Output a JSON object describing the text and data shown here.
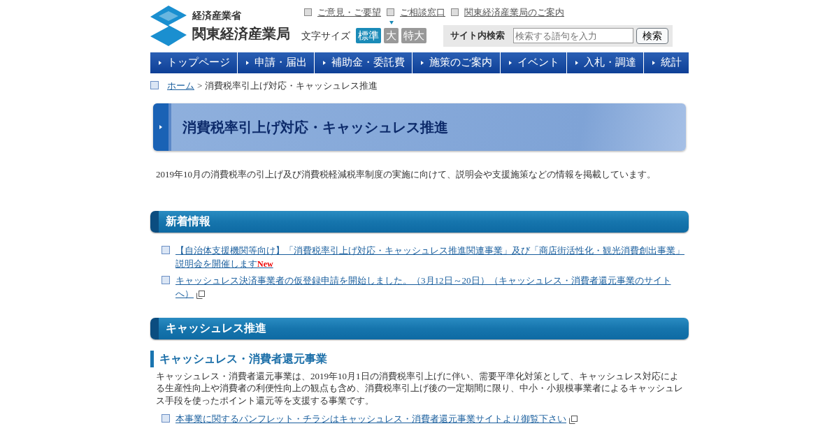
{
  "header": {
    "logo": {
      "ministry": "経済産業省",
      "bureau": "関東経済産業局"
    },
    "top_links": [
      "ご意見・ご要望",
      "ご相談窓口",
      "関東経済産業局のご案内"
    ],
    "font_size": {
      "label": "文字サイズ",
      "options": [
        {
          "label": "標準",
          "selected": true
        },
        {
          "label": "大",
          "selected": false
        },
        {
          "label": "特大",
          "selected": false
        }
      ]
    },
    "search": {
      "label": "サイト内検索",
      "placeholder": "検索する語句を入力",
      "button": "検索"
    }
  },
  "nav": [
    "トップページ",
    "申請・届出",
    "補助金・委託費",
    "施策のご案内",
    "イベント",
    "入札・調達",
    "統計"
  ],
  "breadcrumb": {
    "home": "ホーム",
    "separator": ">",
    "current": "消費税率引上げ対応・キャッシュレス推進"
  },
  "page_title": "消費税率引上げ対応・キャッシュレス推進",
  "intro": "2019年10月の消費税率の引上げ及び消費税軽減税率制度の実施に向けて、説明会や支援施策などの情報を掲載しています。",
  "sections": [
    {
      "heading": "新着情報",
      "blocks": [
        {
          "kind": "link",
          "text": "【自治体支援機関等向け】「消費税率引上げ対応・キャッシュレス推進関連事業」及び「商店街活性化・観光消費創出事業」説明会を開催します",
          "badge": "New",
          "external": false
        },
        {
          "kind": "link",
          "text": "キャッシュレス決済事業者の仮登録申請を開始しました。（3月12日～20日）（キャッシュレス・消費者還元事業のサイトへ）",
          "external": true
        }
      ]
    },
    {
      "heading": "キャッシュレス推進",
      "blocks": [
        {
          "kind": "subheading",
          "text": "キャッシュレス・消費者還元事業"
        },
        {
          "kind": "paragraph",
          "text": "キャッシュレス・消費者還元事業は、2019年10月1日の消費税率引上げに伴い、需要平準化対策として、キャッシュレス対応による生産性向上や消費者の利便性向上の観点も含め、消費税率引上げ後の一定期間に限り、中小・小規模事業者によるキャッシュレス手段を使ったポイント還元等を支援する事業です。"
        },
        {
          "kind": "link",
          "text": "本事業に関するパンフレット・チラシはキャッシュレス・消費者還元事業サイトより御覧下さい",
          "external": true
        }
      ]
    }
  ]
}
